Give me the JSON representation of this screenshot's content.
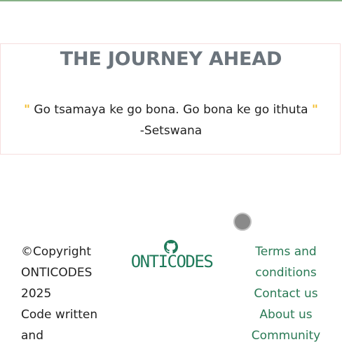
{
  "quote_section": {
    "title": "THE JOURNEY AHEAD",
    "open_mark": "\"",
    "quote": "Go tsamaya ke go bona. Go bona ke go ithuta",
    "close_mark": "\"",
    "source": "-Setswana"
  },
  "footer": {
    "copyright_lines": [
      "©Copyright",
      "ONTICODES",
      "2025",
      "Code written",
      "and"
    ],
    "logo_text": "ONTICODES",
    "logo_icon": "github-icon",
    "links": [
      "Terms and conditions",
      "Contact us",
      "About us",
      "Community"
    ]
  },
  "colors": {
    "top_bar": "#86b186",
    "title": "#6b747c",
    "quote_mark": "#f2bd2c",
    "brand_green": "#1f7a5a",
    "link_green": "#2a7a55",
    "scroll_dot": "#8a8a8a"
  }
}
